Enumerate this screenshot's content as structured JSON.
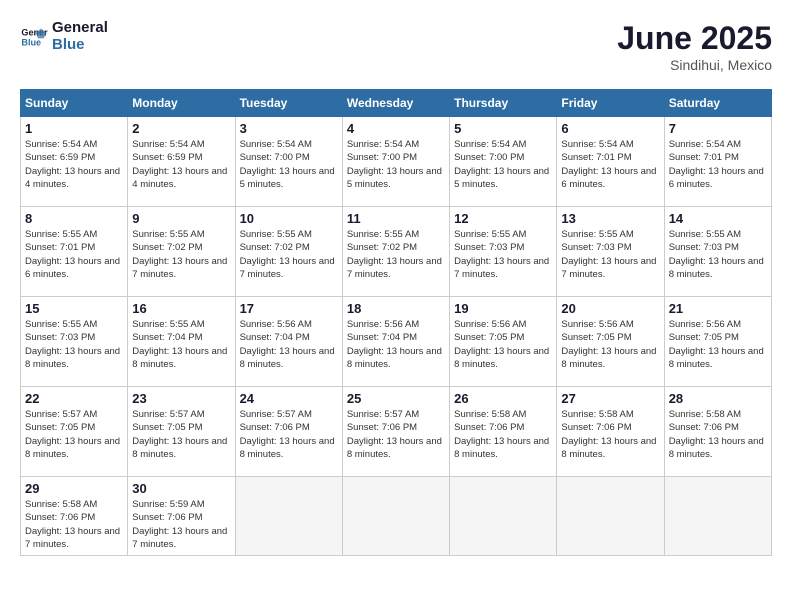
{
  "header": {
    "logo_line1": "General",
    "logo_line2": "Blue",
    "month_year": "June 2025",
    "location": "Sindihui, Mexico"
  },
  "weekdays": [
    "Sunday",
    "Monday",
    "Tuesday",
    "Wednesday",
    "Thursday",
    "Friday",
    "Saturday"
  ],
  "weeks": [
    [
      {
        "day": 1,
        "sunrise": "5:54 AM",
        "sunset": "6:59 PM",
        "daylight": "13 hours and 4 minutes."
      },
      {
        "day": 2,
        "sunrise": "5:54 AM",
        "sunset": "6:59 PM",
        "daylight": "13 hours and 4 minutes."
      },
      {
        "day": 3,
        "sunrise": "5:54 AM",
        "sunset": "7:00 PM",
        "daylight": "13 hours and 5 minutes."
      },
      {
        "day": 4,
        "sunrise": "5:54 AM",
        "sunset": "7:00 PM",
        "daylight": "13 hours and 5 minutes."
      },
      {
        "day": 5,
        "sunrise": "5:54 AM",
        "sunset": "7:00 PM",
        "daylight": "13 hours and 5 minutes."
      },
      {
        "day": 6,
        "sunrise": "5:54 AM",
        "sunset": "7:01 PM",
        "daylight": "13 hours and 6 minutes."
      },
      {
        "day": 7,
        "sunrise": "5:54 AM",
        "sunset": "7:01 PM",
        "daylight": "13 hours and 6 minutes."
      }
    ],
    [
      {
        "day": 8,
        "sunrise": "5:55 AM",
        "sunset": "7:01 PM",
        "daylight": "13 hours and 6 minutes."
      },
      {
        "day": 9,
        "sunrise": "5:55 AM",
        "sunset": "7:02 PM",
        "daylight": "13 hours and 7 minutes."
      },
      {
        "day": 10,
        "sunrise": "5:55 AM",
        "sunset": "7:02 PM",
        "daylight": "13 hours and 7 minutes."
      },
      {
        "day": 11,
        "sunrise": "5:55 AM",
        "sunset": "7:02 PM",
        "daylight": "13 hours and 7 minutes."
      },
      {
        "day": 12,
        "sunrise": "5:55 AM",
        "sunset": "7:03 PM",
        "daylight": "13 hours and 7 minutes."
      },
      {
        "day": 13,
        "sunrise": "5:55 AM",
        "sunset": "7:03 PM",
        "daylight": "13 hours and 7 minutes."
      },
      {
        "day": 14,
        "sunrise": "5:55 AM",
        "sunset": "7:03 PM",
        "daylight": "13 hours and 8 minutes."
      }
    ],
    [
      {
        "day": 15,
        "sunrise": "5:55 AM",
        "sunset": "7:03 PM",
        "daylight": "13 hours and 8 minutes."
      },
      {
        "day": 16,
        "sunrise": "5:55 AM",
        "sunset": "7:04 PM",
        "daylight": "13 hours and 8 minutes."
      },
      {
        "day": 17,
        "sunrise": "5:56 AM",
        "sunset": "7:04 PM",
        "daylight": "13 hours and 8 minutes."
      },
      {
        "day": 18,
        "sunrise": "5:56 AM",
        "sunset": "7:04 PM",
        "daylight": "13 hours and 8 minutes."
      },
      {
        "day": 19,
        "sunrise": "5:56 AM",
        "sunset": "7:05 PM",
        "daylight": "13 hours and 8 minutes."
      },
      {
        "day": 20,
        "sunrise": "5:56 AM",
        "sunset": "7:05 PM",
        "daylight": "13 hours and 8 minutes."
      },
      {
        "day": 21,
        "sunrise": "5:56 AM",
        "sunset": "7:05 PM",
        "daylight": "13 hours and 8 minutes."
      }
    ],
    [
      {
        "day": 22,
        "sunrise": "5:57 AM",
        "sunset": "7:05 PM",
        "daylight": "13 hours and 8 minutes."
      },
      {
        "day": 23,
        "sunrise": "5:57 AM",
        "sunset": "7:05 PM",
        "daylight": "13 hours and 8 minutes."
      },
      {
        "day": 24,
        "sunrise": "5:57 AM",
        "sunset": "7:06 PM",
        "daylight": "13 hours and 8 minutes."
      },
      {
        "day": 25,
        "sunrise": "5:57 AM",
        "sunset": "7:06 PM",
        "daylight": "13 hours and 8 minutes."
      },
      {
        "day": 26,
        "sunrise": "5:58 AM",
        "sunset": "7:06 PM",
        "daylight": "13 hours and 8 minutes."
      },
      {
        "day": 27,
        "sunrise": "5:58 AM",
        "sunset": "7:06 PM",
        "daylight": "13 hours and 8 minutes."
      },
      {
        "day": 28,
        "sunrise": "5:58 AM",
        "sunset": "7:06 PM",
        "daylight": "13 hours and 8 minutes."
      }
    ],
    [
      {
        "day": 29,
        "sunrise": "5:58 AM",
        "sunset": "7:06 PM",
        "daylight": "13 hours and 7 minutes."
      },
      {
        "day": 30,
        "sunrise": "5:59 AM",
        "sunset": "7:06 PM",
        "daylight": "13 hours and 7 minutes."
      },
      null,
      null,
      null,
      null,
      null
    ]
  ],
  "labels": {
    "sunrise": "Sunrise:",
    "sunset": "Sunset:",
    "daylight": "Daylight:"
  }
}
